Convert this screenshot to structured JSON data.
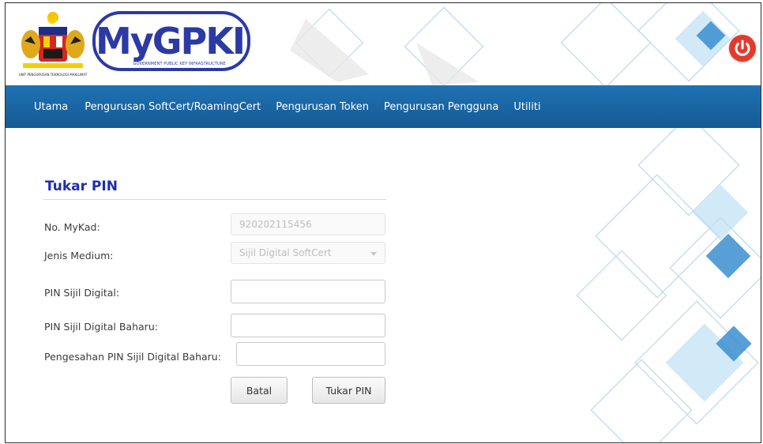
{
  "header": {
    "crest_caption": "UNIT PENGURUSAN TEKNOLOGI MAKLUMAT",
    "logo_main": "MyGPKI",
    "logo_subtitle": "GOVERNMENT PUBLIC KEY INFRASTRUCTURE",
    "power_icon": "power-icon"
  },
  "nav": {
    "items": [
      {
        "label": "Utama"
      },
      {
        "label": "Pengurusan SoftCert/RoamingCert"
      },
      {
        "label": "Pengurusan Token"
      },
      {
        "label": "Pengurusan Pengguna"
      },
      {
        "label": "Utiliti"
      }
    ]
  },
  "form": {
    "title": "Tukar PIN",
    "mykad_label": "No. MyKad:",
    "mykad_value": "920202115456",
    "medium_label": "Jenis Medium:",
    "medium_value": "Sijil Digital SoftCert",
    "pin_label": "PIN Sijil Digital:",
    "pin_value": "",
    "new_pin_label": "PIN Sijil Digital Baharu:",
    "new_pin_value": "",
    "confirm_pin_label": "Pengesahan PIN Sijil Digital Baharu:",
    "confirm_pin_value": "",
    "cancel_label": "Batal",
    "submit_label": "Tukar PIN"
  },
  "colors": {
    "nav_bar": "#1a67a6",
    "title": "#1c2db2",
    "power_button": "#e23b2e",
    "deco_blue": "#3a8fd0"
  }
}
